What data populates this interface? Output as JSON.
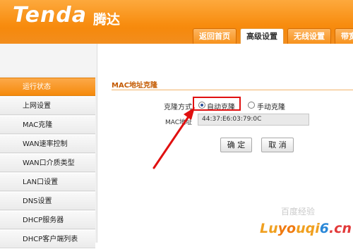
{
  "header": {
    "logo_text": "Tenda",
    "logo_cn": "腾达",
    "tabs": [
      {
        "label": "返回首页"
      },
      {
        "label": "高级设置"
      },
      {
        "label": "无线设置"
      },
      {
        "label": "带宽"
      }
    ]
  },
  "sidebar": {
    "items": [
      {
        "label": "运行状态"
      },
      {
        "label": "上网设置"
      },
      {
        "label": "MAC克隆"
      },
      {
        "label": "WAN速率控制"
      },
      {
        "label": "WAN口介质类型"
      },
      {
        "label": "LAN口设置"
      },
      {
        "label": "DNS设置"
      },
      {
        "label": "DHCP服务器"
      },
      {
        "label": "DHCP客户端列表"
      }
    ]
  },
  "main": {
    "title": "MAC地址克隆",
    "method_label": "克隆方式",
    "option_auto": "自动克隆",
    "option_manual": "手动克隆",
    "mac_label": "MAC地址",
    "mac_value": "44:37:E6:03:79:0C",
    "confirm_label": "确 定",
    "cancel_label": "取 消"
  },
  "watermark": {
    "text_a": "Lu",
    "text_b": "yo",
    "text_c": "uqi",
    "text_d": "6",
    "text_e": ".cn",
    "cn": "百度经验"
  },
  "colors": {
    "header_orange": "#f88d10",
    "active_nav": "#f58a0c",
    "highlight_red": "#e01010"
  }
}
